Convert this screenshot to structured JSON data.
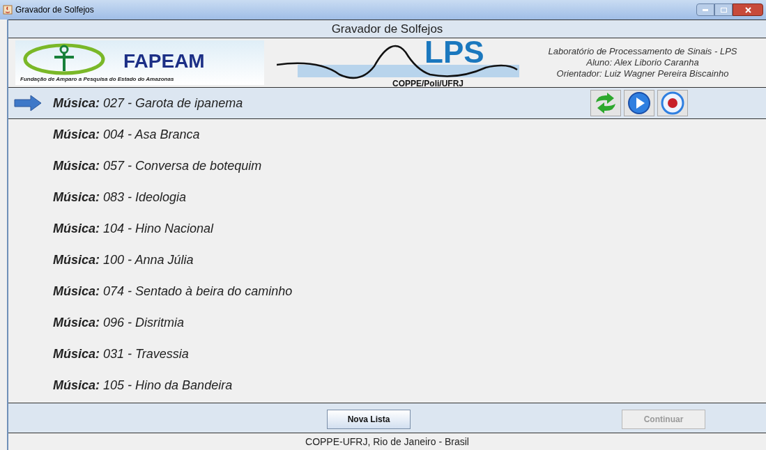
{
  "window": {
    "title": "Gravador de Solfejos"
  },
  "header": {
    "title": "Gravador de Solfejos"
  },
  "logos": {
    "fapeam": {
      "name": "FAPEAM",
      "subtitle": "Fundação de Amparo a Pesquisa do Estado do Amazonas"
    },
    "lps": {
      "name": "LPS",
      "subtitle": "COPPE/Poli/UFRJ"
    }
  },
  "credits": [
    "Laboratório de Processamento de Sinais - LPS",
    "Aluno: Alex Liborio Caranha",
    "Orientador: Luiz Wagner Pereira Biscainho"
  ],
  "songs": [
    {
      "label": "**Música:** 027 - Garota de ipanema",
      "selected": true
    },
    {
      "label": "**Música:** 004 - Asa Branca",
      "selected": false
    },
    {
      "label": "**Música:** 057 - Conversa de botequim",
      "selected": false
    },
    {
      "label": "**Música:** 083 - Ideologia",
      "selected": false
    },
    {
      "label": "**Música:** 104 - Hino Nacional",
      "selected": false
    },
    {
      "label": "**Música:** 100 - Anna Júlia",
      "selected": false
    },
    {
      "label": "**Música:** 074 - Sentado à beira do caminho",
      "selected": false
    },
    {
      "label": "**Música:** 096 - Disritmia",
      "selected": false
    },
    {
      "label": "**Música:** 031 - Travessia",
      "selected": false
    },
    {
      "label": "**Música:** 105 - Hino da Bandeira",
      "selected": false
    }
  ],
  "buttons": [
    {
      "label": "Nova Lista",
      "disabled": false
    },
    {
      "label": "Continuar",
      "disabled": true
    }
  ],
  "footer": "COPPE-UFRJ, Rio de Janeiro - Brasil"
}
